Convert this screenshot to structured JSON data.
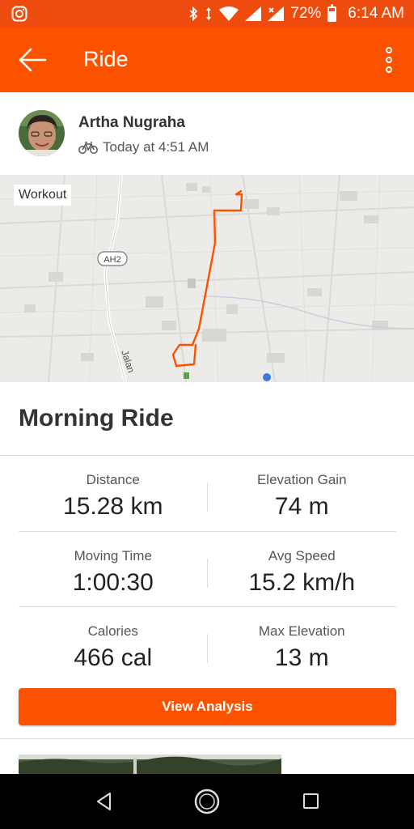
{
  "status_bar": {
    "battery_percent": "72%",
    "time": "6:14 AM",
    "left_icon": "instagram-icon",
    "right_icons": [
      "bluetooth-icon",
      "data-arrows-icon",
      "wifi-icon",
      "signal-icon",
      "signal-x-icon",
      "battery-icon"
    ]
  },
  "app_bar": {
    "title": "Ride",
    "back_icon": "arrow-left-icon",
    "menu_icon": "more-vertical-icon"
  },
  "athlete": {
    "name": "Artha Nugraha",
    "activity_icon": "bike-icon",
    "timestamp": "Today at 4:51 AM"
  },
  "map": {
    "badge": "Workout",
    "road_shield": "AH2",
    "street_label": "Jalan"
  },
  "activity": {
    "title": "Morning Ride"
  },
  "stats": [
    [
      {
        "label": "Distance",
        "value": "15.28 km"
      },
      {
        "label": "Elevation Gain",
        "value": "74 m"
      }
    ],
    [
      {
        "label": "Moving Time",
        "value": "1:00:30"
      },
      {
        "label": "Avg Speed",
        "value": "15.2 km/h"
      }
    ],
    [
      {
        "label": "Calories",
        "value": "466 cal"
      },
      {
        "label": "Max Elevation",
        "value": "13 m"
      }
    ]
  ],
  "actions": {
    "view_analysis": "View Analysis"
  },
  "colors": {
    "brand": "#fc5200",
    "status_bar": "#ee4c0e",
    "route": "#fc5200"
  }
}
